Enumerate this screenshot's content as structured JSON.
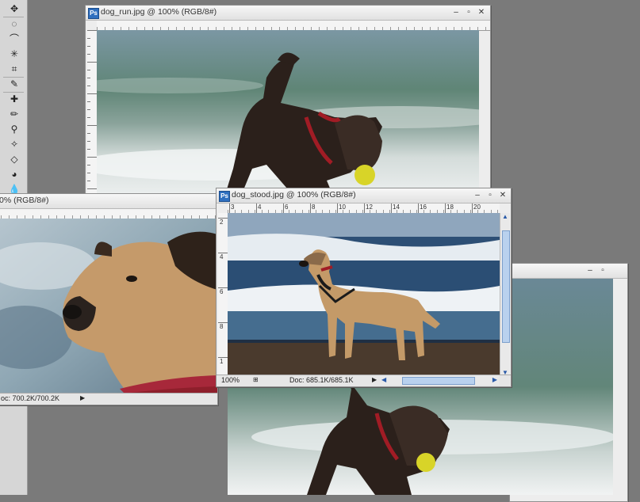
{
  "toolbox": {
    "tools": [
      "move-tool",
      "lasso-tool",
      "ellipse-marquee-tool",
      "magic-wand-tool",
      "crop-tool",
      "eyedropper-tool",
      "healing-brush-tool",
      "brush-tool",
      "clone-stamp-tool",
      "history-brush-tool",
      "eraser-tool",
      "paint-bucket-tool",
      "blur-tool"
    ],
    "glyphs": [
      "✥",
      "◌",
      "⌒",
      "✳",
      "⌗",
      "✎",
      "✚",
      "✏",
      "⚲",
      "✧",
      "◇",
      "◕",
      "💧"
    ]
  },
  "windows": {
    "dog_run": {
      "title": "dog_run.jpg @ 100% (RGB/8#)",
      "controls": {
        "minimize": "‒",
        "restore": "▫",
        "close": "✕"
      }
    },
    "dog_head": {
      "title": "0% (RGB/8#)",
      "status_doc": "oc: 700.2K/700.2K"
    },
    "dog_run_copy": {
      "controls": {
        "minimize": "‒",
        "restore": "▫"
      }
    },
    "dog_stood": {
      "title": "dog_stood.jpg @ 100% (RGB/8#)",
      "controls": {
        "minimize": "‒",
        "restore": "▫",
        "close": "✕"
      },
      "ruler_h_numbers": [
        "3",
        "4",
        "6",
        "8",
        "10",
        "12",
        "14",
        "16",
        "18",
        "20"
      ],
      "ruler_v_numbers": [
        "2",
        "4",
        "6",
        "8",
        "1"
      ],
      "zoom": "100%",
      "status_doc": "Doc: 685.1K/685.1K"
    }
  },
  "colors": {
    "workspace": "#7a7a7a",
    "scroll_accent": "#b9d1ee"
  }
}
